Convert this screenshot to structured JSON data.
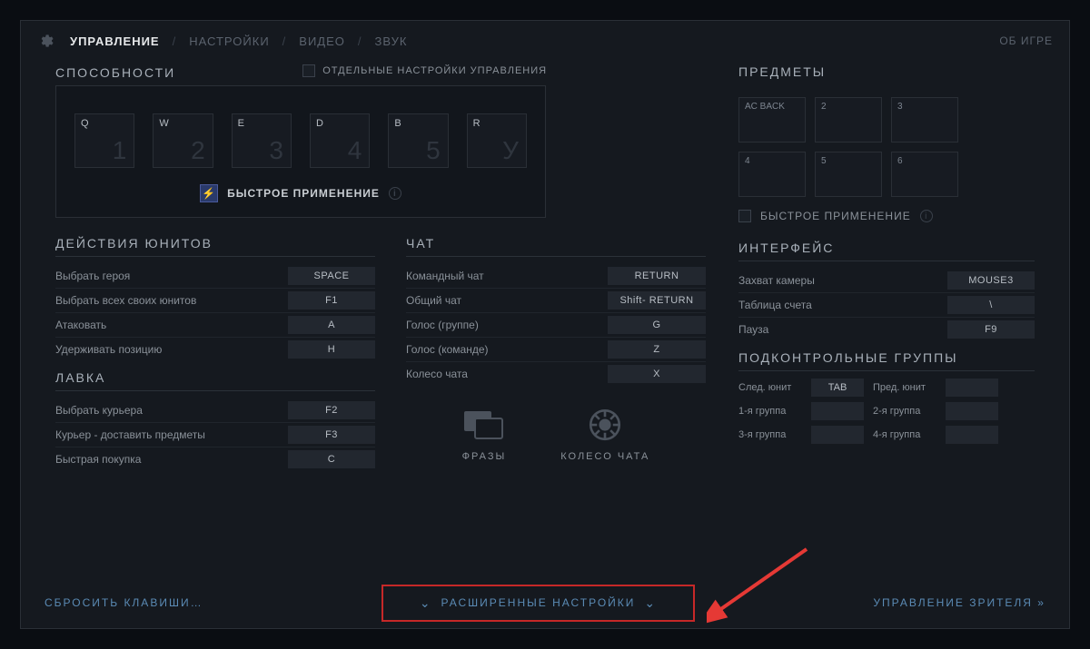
{
  "nav": {
    "items": [
      "УПРАВЛЕНИЕ",
      "НАСТРОЙКИ",
      "ВИДЕО",
      "ЗВУК"
    ],
    "about": "ОБ ИГРЕ"
  },
  "abilities": {
    "title": "СПОСОБНОСТИ",
    "separate_checkbox": "ОТДЕЛЬНЫЕ НАСТРОЙКИ УПРАВЛЕНИЯ",
    "slots": [
      {
        "key": "Q",
        "num": "1"
      },
      {
        "key": "W",
        "num": "2"
      },
      {
        "key": "E",
        "num": "3"
      },
      {
        "key": "D",
        "num": "4"
      },
      {
        "key": "B",
        "num": "5"
      },
      {
        "key": "R",
        "num": "У"
      }
    ],
    "quickcast": "БЫСТРОЕ ПРИМЕНЕНИЕ"
  },
  "items": {
    "title": "ПРЕДМЕТЫ",
    "slots": [
      "AC BACK",
      "2",
      "3",
      "4",
      "5",
      "6"
    ],
    "quickcast": "БЫСТРОЕ ПРИМЕНЕНИЕ"
  },
  "unit_actions": {
    "title": "ДЕЙСТВИЯ ЮНИТОВ",
    "rows": [
      {
        "label": "Выбрать героя",
        "key": "SPACE"
      },
      {
        "label": "Выбрать всех своих юнитов",
        "key": "F1"
      },
      {
        "label": "Атаковать",
        "key": "A"
      },
      {
        "label": "Удерживать позицию",
        "key": "H"
      }
    ]
  },
  "shop": {
    "title": "ЛАВКА",
    "rows": [
      {
        "label": "Выбрать курьера",
        "key": "F2"
      },
      {
        "label": "Курьер - доставить предметы",
        "key": "F3"
      },
      {
        "label": "Быстрая покупка",
        "key": "C"
      }
    ]
  },
  "chat": {
    "title": "ЧАТ",
    "rows": [
      {
        "label": "Командный чат",
        "key": "RETURN"
      },
      {
        "label": "Общий чат",
        "key": "Shift- RETURN"
      },
      {
        "label": "Голос (группе)",
        "key": "G"
      },
      {
        "label": "Голос (команде)",
        "key": "Z"
      },
      {
        "label": "Колесо чата",
        "key": "X"
      }
    ],
    "phrases": "ФРАЗЫ",
    "wheel": "КОЛЕСО ЧАТА"
  },
  "interface": {
    "title": "ИНТЕРФЕЙС",
    "rows": [
      {
        "label": "Захват камеры",
        "key": "MOUSE3"
      },
      {
        "label": "Таблица счета",
        "key": "\\"
      },
      {
        "label": "Пауза",
        "key": "F9"
      }
    ]
  },
  "groups": {
    "title": "ПОДКОНТРОЛЬНЫЕ ГРУППЫ",
    "next_unit": "След. юнит",
    "next_key": "TAB",
    "prev_unit": "Пред. юнит",
    "prev_key": "",
    "g1": "1-я группа",
    "g1k": "",
    "g2": "2-я группа",
    "g2k": "",
    "g3": "3-я группа",
    "g3k": "",
    "g4": "4-я группа",
    "g4k": ""
  },
  "bottom": {
    "reset": "СБРОСИТЬ КЛАВИШИ…",
    "advanced": "РАСШИРЕННЫЕ НАСТРОЙКИ",
    "spectator": "УПРАВЛЕНИЕ ЗРИТЕЛЯ"
  }
}
